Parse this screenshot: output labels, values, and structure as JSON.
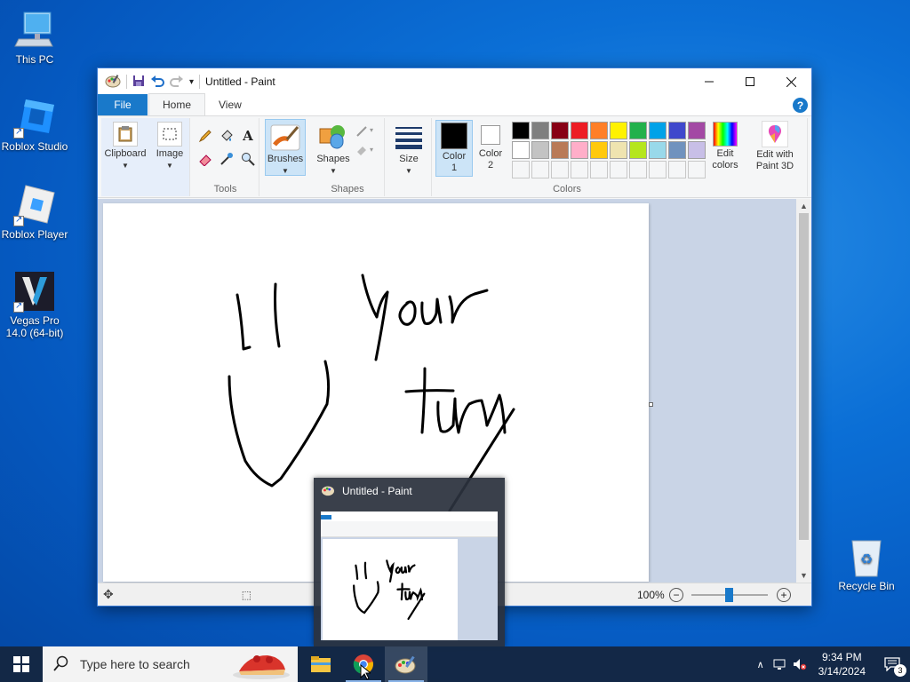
{
  "desktop": {
    "icons": [
      {
        "label": "This PC",
        "icon": "computer-icon"
      },
      {
        "label": "Roblox Studio",
        "icon": "roblox-studio-icon"
      },
      {
        "label": "Roblox Player",
        "icon": "roblox-player-icon"
      },
      {
        "label": "Vegas Pro 14.0 (64-bit)",
        "icon": "vegas-pro-icon"
      },
      {
        "label": "Recycle Bin",
        "icon": "recycle-bin-icon"
      }
    ]
  },
  "paint": {
    "title": "Untitled - Paint",
    "tabs": {
      "file": "File",
      "home": "Home",
      "view": "View"
    },
    "help": "?",
    "ribbon": {
      "clipboard": "Clipboard",
      "image": "Image",
      "tools_label": "Tools",
      "brushes": "Brushes",
      "shapes": "Shapes",
      "shapes_label": "Shapes",
      "size": "Size",
      "color1": "Color 1",
      "color2": "Color 2",
      "colors_label": "Colors",
      "edit_colors": "Edit colors",
      "edit_paint3d": "Edit with Paint 3D"
    },
    "palette_row1": [
      "#000000",
      "#7f7f7f",
      "#880015",
      "#ed1c24",
      "#ff7f27",
      "#fff200",
      "#22b14c",
      "#00a2e8",
      "#3f48cc",
      "#a349a4"
    ],
    "palette_row2": [
      "#ffffff",
      "#c3c3c3",
      "#b97a57",
      "#ffaec9",
      "#ffc90e",
      "#efe4b0",
      "#b5e61d",
      "#99d9ea",
      "#7092be",
      "#c8bfe7"
    ],
    "color1_value": "#000000",
    "color2_value": "#ffffff",
    "status": {
      "zoom": "100%"
    }
  },
  "taskbar": {
    "search_placeholder": "Type here to search",
    "apps": [
      "file-explorer-icon",
      "chrome-icon",
      "paint-icon"
    ],
    "time": "9:34 PM",
    "date": "3/14/2024",
    "notification_count": "3"
  },
  "thumbnail": {
    "title": "Untitled - Paint"
  }
}
